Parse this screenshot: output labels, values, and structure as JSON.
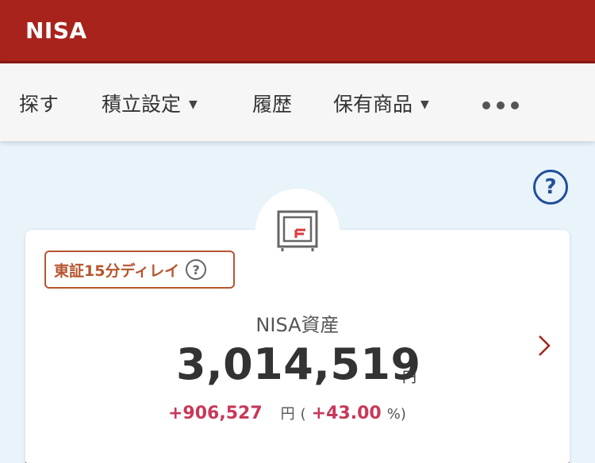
{
  "header": {
    "title": "NISA"
  },
  "nav": {
    "items": [
      {
        "label": "探す"
      },
      {
        "label": "積立設定",
        "caret": "▼"
      },
      {
        "label": "履歴"
      },
      {
        "label": "保有商品",
        "caret": "▼"
      }
    ],
    "more_icon": "more-dots-icon"
  },
  "help": {
    "label": "?"
  },
  "card": {
    "delay_badge": {
      "label": "東証15分ディレイ",
      "help": "?"
    },
    "asset_label": "NISA資産",
    "asset_value": "3,014,519",
    "asset_unit": "円",
    "change_amount": "+906,527",
    "change_unit": "円",
    "open_paren": "(",
    "change_percent": "+43.00",
    "percent_sign": "%",
    "close_paren": ")"
  },
  "colors": {
    "brand": "#a8231c",
    "gain": "#c8385a",
    "help": "#1f4f99"
  }
}
